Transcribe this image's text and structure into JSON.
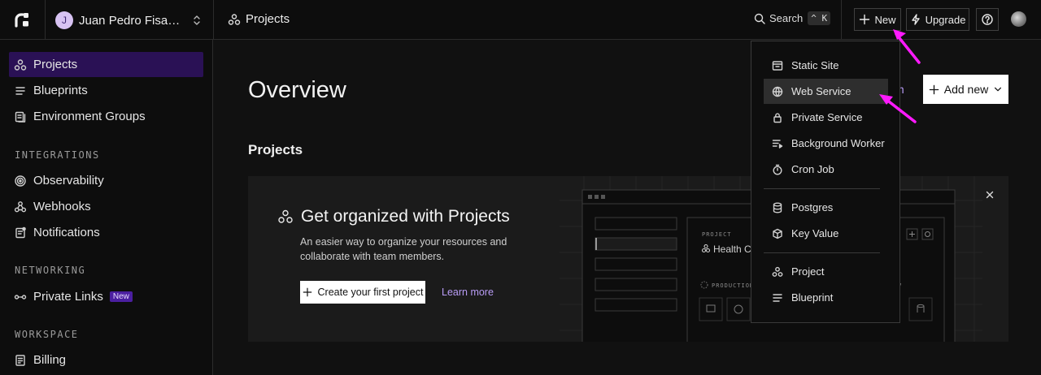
{
  "topbar": {
    "workspace_initial": "J",
    "workspace_name": "Juan Pedro Fisanotti",
    "breadcrumb": "Projects",
    "search_label": "Search",
    "search_shortcut": "^ K",
    "new_label": "New",
    "upgrade_label": "Upgrade"
  },
  "sidebar": {
    "items": [
      {
        "label": "Projects",
        "icon": "projects-icon"
      },
      {
        "label": "Blueprints",
        "icon": "blueprint-icon"
      },
      {
        "label": "Environment Groups",
        "icon": "env-groups-icon"
      }
    ],
    "sections": {
      "integrations": "INTEGRATIONS",
      "networking": "NETWORKING",
      "workspace": "WORKSPACE"
    },
    "integrations": [
      {
        "label": "Observability",
        "icon": "observability-icon"
      },
      {
        "label": "Webhooks",
        "icon": "webhooks-icon"
      },
      {
        "label": "Notifications",
        "icon": "notifications-icon"
      }
    ],
    "networking": [
      {
        "label": "Private Links",
        "icon": "private-links-icon",
        "badge": "New"
      }
    ],
    "workspace": [
      {
        "label": "Billing",
        "icon": "billing-icon"
      }
    ]
  },
  "main": {
    "title": "Overview",
    "partial_link": "m",
    "add_new_label": "Add new",
    "section_title": "Projects",
    "card": {
      "heading": "Get organized with Projects",
      "description": "An easier way to organize your resources and collaborate with team members.",
      "create_label": "Create your first project",
      "learn_more": "Learn more",
      "illus_project_label": "PROJECT",
      "illus_project_name": "Health C",
      "illus_env_label": "PRODUCTION",
      "illus_env_tail": "V"
    }
  },
  "menu": {
    "items": [
      {
        "label": "Static Site",
        "icon": "static-site-icon"
      },
      {
        "label": "Web Service",
        "icon": "globe-icon"
      },
      {
        "label": "Private Service",
        "icon": "lock-icon"
      },
      {
        "label": "Background Worker",
        "icon": "worker-icon"
      },
      {
        "label": "Cron Job",
        "icon": "stopwatch-icon"
      },
      {
        "label": "Postgres",
        "icon": "database-icon"
      },
      {
        "label": "Key Value",
        "icon": "key-icon"
      },
      {
        "label": "Project",
        "icon": "projects-icon"
      },
      {
        "label": "Blueprint",
        "icon": "blueprint-icon"
      }
    ]
  },
  "colors": {
    "accent": "#b89cf5",
    "active_nav": "#2a1155",
    "annotation_arrow": "#ff1aff"
  }
}
